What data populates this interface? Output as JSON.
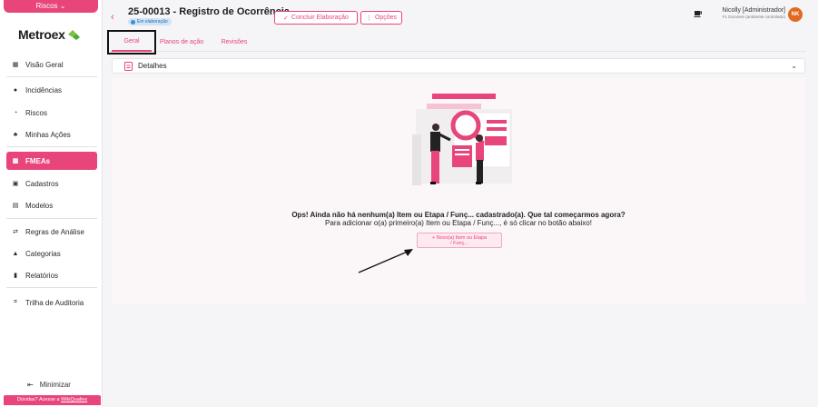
{
  "sidebar": {
    "module": "Riscos",
    "logo": "Metroex",
    "items": [
      {
        "label": "Visão Geral",
        "icon": "dashboard-icon"
      },
      {
        "label": "Incidências",
        "icon": "alert-icon"
      },
      {
        "label": "Riscos",
        "icon": "radar-icon"
      },
      {
        "label": "Minhas Ações",
        "icon": "team-icon"
      },
      {
        "label": "FMEAs",
        "icon": "grid-icon"
      },
      {
        "label": "Cadastros",
        "icon": "folder-icon"
      },
      {
        "label": "Modelos",
        "icon": "template-icon"
      },
      {
        "label": "Regras de Análise",
        "icon": "rules-icon"
      },
      {
        "label": "Categorias",
        "icon": "categories-icon"
      },
      {
        "label": "Relatórios",
        "icon": "report-icon"
      },
      {
        "label": "Trilha de Auditoria",
        "icon": "audit-icon"
      }
    ],
    "minimize": "Minimizar",
    "footer_text": "Dúvidas? Acesse a",
    "footer_link": "WikiQualiex"
  },
  "header": {
    "title": "25-00013 - Registro de Ocorrência",
    "status": "Em elaboração",
    "conclude_button": "Concluir Elaboração",
    "options_button": "Opções",
    "user_name": "Nicolly [Administrador]",
    "user_sub": "FL Docviere (ambiente controlado)",
    "avatar_initials": "NK"
  },
  "tabs": [
    "Geral",
    "Planos de ação",
    "Revisões"
  ],
  "details": {
    "label": "Detalhes"
  },
  "empty_state": {
    "title": "Ops! Ainda não há nenhum(a) Item ou Etapa / Funç... cadastrado(a). Que tal começarmos agora?",
    "subtitle": "Para adicionar o(a) primeiro(a) Item ou Etapa / Funç..., é só clicar no botão abaixo!",
    "button_line1": "+ Novo(a) Item ou Etapa",
    "button_line2": "/ Funç..."
  },
  "colors": {
    "accent": "#e8457a",
    "status_badge": "#cfe5f7"
  }
}
